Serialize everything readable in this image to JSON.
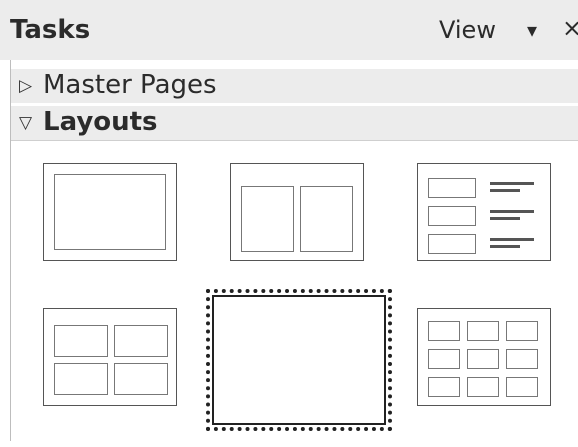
{
  "header": {
    "title": "Tasks",
    "view_label": "View",
    "view_arrow": "▾",
    "close": "×"
  },
  "sections": {
    "master_pages": {
      "label": "Master Pages",
      "expanded": false,
      "icon": "triangle-right-icon"
    },
    "layouts": {
      "label": "Layouts",
      "expanded": true,
      "icon": "triangle-down-icon"
    }
  },
  "layouts": {
    "items": [
      {
        "id": "title-content",
        "selected": false
      },
      {
        "id": "title-2-content",
        "selected": false
      },
      {
        "id": "title-content-and-2-lines",
        "selected": false
      },
      {
        "id": "title-4-content",
        "selected": false
      },
      {
        "id": "title-6-content",
        "selected": true
      },
      {
        "id": "title-9-content",
        "selected": false
      }
    ]
  },
  "colors": {
    "panel_bg": "#ffffff",
    "header_bg": "#ececec",
    "tile_border": "#555555",
    "selection": "#222222"
  }
}
